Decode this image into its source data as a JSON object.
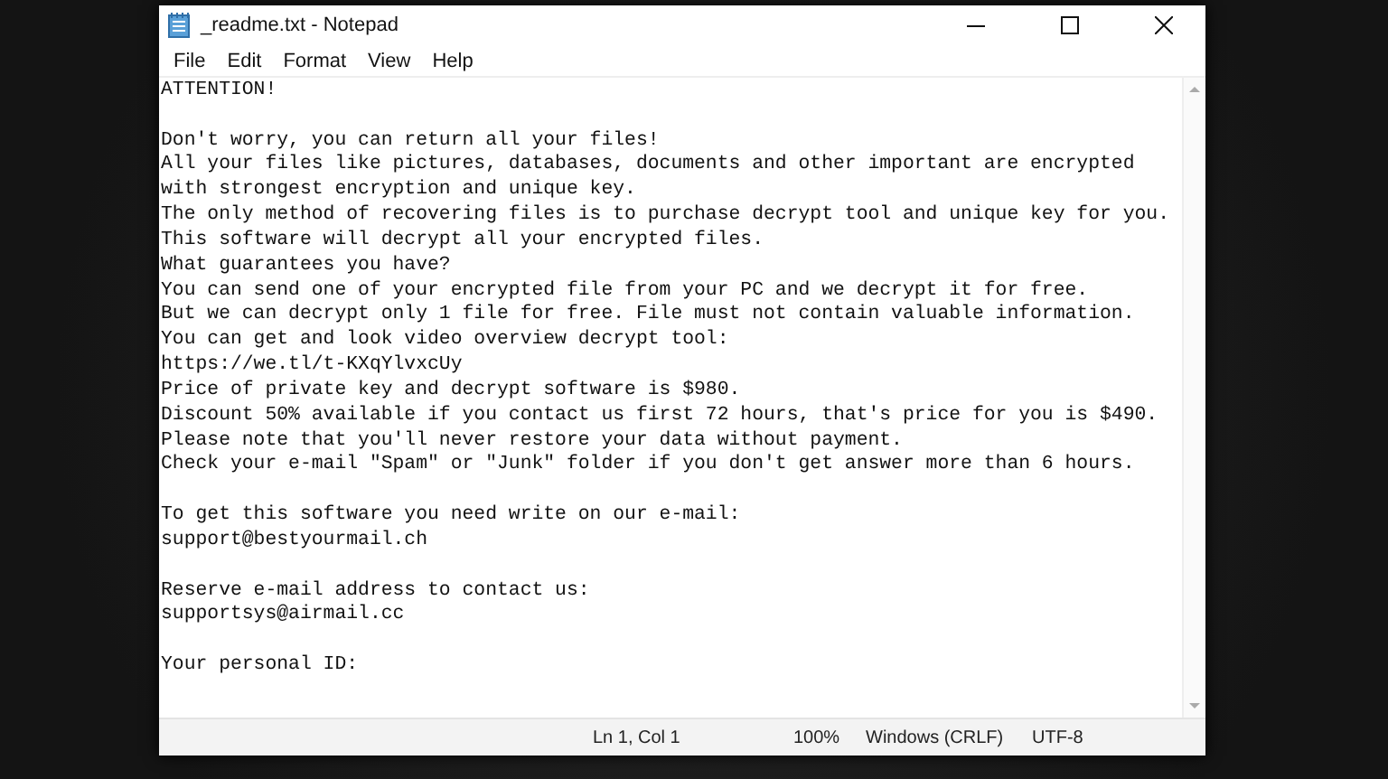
{
  "window": {
    "title": "_readme.txt - Notepad"
  },
  "menu": [
    "File",
    "Edit",
    "Format",
    "View",
    "Help"
  ],
  "document": {
    "message": [
      {
        "lines": [
          "ATTENTION!"
        ]
      },
      {
        "lines": [
          "Don't worry, you can return all your files!",
          "All your files like pictures, databases, documents and other important are encrypted",
          "with strongest encryption and unique key.",
          "The only method of recovering files is to purchase decrypt tool and unique key for you.",
          "This software will decrypt all your encrypted files.",
          "What guarantees you have?",
          "You can send one of your encrypted file from your PC and we decrypt it for free.",
          "But we can decrypt only 1 file for free. File must not contain valuable information.",
          "You can get and look video overview decrypt tool:",
          "https://we.tl/t-KXqYlvxcUy",
          "Price of private key and decrypt software is $980.",
          "Discount 50% available if you contact us first 72 hours, that's price for you is $490.",
          "Please note that you'll never restore your data without payment.",
          "Check your e-mail \"Spam\" or \"Junk\" folder if you don't get answer more than 6 hours."
        ]
      }
    ],
    "contacts": [
      {
        "lines": [
          "To get this software you need write on our e-mail:",
          "support@bestyourmail.ch"
        ]
      },
      {
        "lines": [
          "Reserve e-mail address to contact us:",
          "supportsys@airmail.cc"
        ]
      },
      {
        "lines": [
          "Your personal ID:"
        ]
      }
    ]
  },
  "status_bar": {
    "position": "Ln 1, Col 1",
    "zoom": "100%",
    "line_endings": "Windows (CRLF)",
    "encoding": "UTF-8"
  }
}
